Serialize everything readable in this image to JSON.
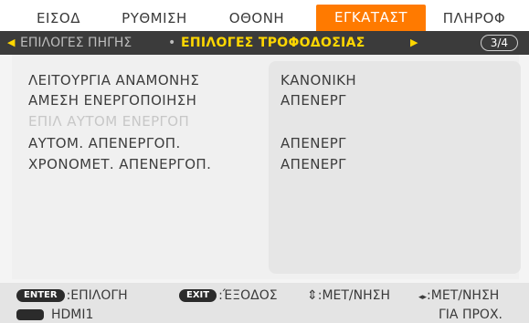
{
  "tabs": [
    {
      "label": "ΕΙΣΟΔ",
      "active": false
    },
    {
      "label": "ΡΥΘΜΙΣΗ",
      "active": false
    },
    {
      "label": "ΟΘΟΝΗ",
      "active": false
    },
    {
      "label": "ΕΓΚΑΤΑΣΤ",
      "active": true
    },
    {
      "label": "ΠΛΗΡΟΦ",
      "active": false
    }
  ],
  "breadcrumb": {
    "prev": "ΕΠΙΛΟΓΕΣ ΠΗΓΗΣ",
    "separator": "•",
    "current": "ΕΠΙΛΟΓΕΣ ΤΡΟΦΟΔΟΣΙΑΣ",
    "page": "3/4"
  },
  "settings": [
    {
      "label": "ΛΕΙΤΟΥΡΓΙΑ ΑΝΑΜΟΝΗΣ",
      "value": "ΚΑΝΟΝΙΚΗ",
      "enabled": true
    },
    {
      "label": "ΑΜΕΣΗ ΕΝΕΡΓΟΠΟΙΗΣΗ",
      "value": "ΑΠΕΝΕΡΓ",
      "enabled": true
    },
    {
      "label": "ΕΠΙΛ ΑΥΤΟΜ ΕΝΕΡΓΟΠ",
      "value": "",
      "enabled": false
    },
    {
      "label": "ΑΥΤΟΜ. ΑΠΕΝΕΡΓΟΠ.",
      "value": "ΑΠΕΝΕΡΓ",
      "enabled": true
    },
    {
      "label": "ΧΡΟΝΟΜΕΤ. ΑΠΕΝΕΡΓΟΠ.",
      "value": "ΑΠΕΝΕΡΓ",
      "enabled": true
    }
  ],
  "footer": {
    "enter_key": "ENTER",
    "enter_label": ":ΕΠΙΛΟΓΗ",
    "exit_key": "EXIT",
    "exit_label": ":ΈΞΟΔΟΣ",
    "updown_icon": "⇕",
    "updown_label": ":ΜΕΤ/ΝΗΣΗ",
    "leftright_icon": "◂▸",
    "leftright_label": ":ΜΕΤ/ΝΗΣΗ",
    "source": "HDMI1",
    "mode": "ΓΙΑ ΠΡΟΧ."
  },
  "colors": {
    "accent": "#ff7a00",
    "highlight": "#ffd700",
    "bar": "#3b3b3b"
  }
}
